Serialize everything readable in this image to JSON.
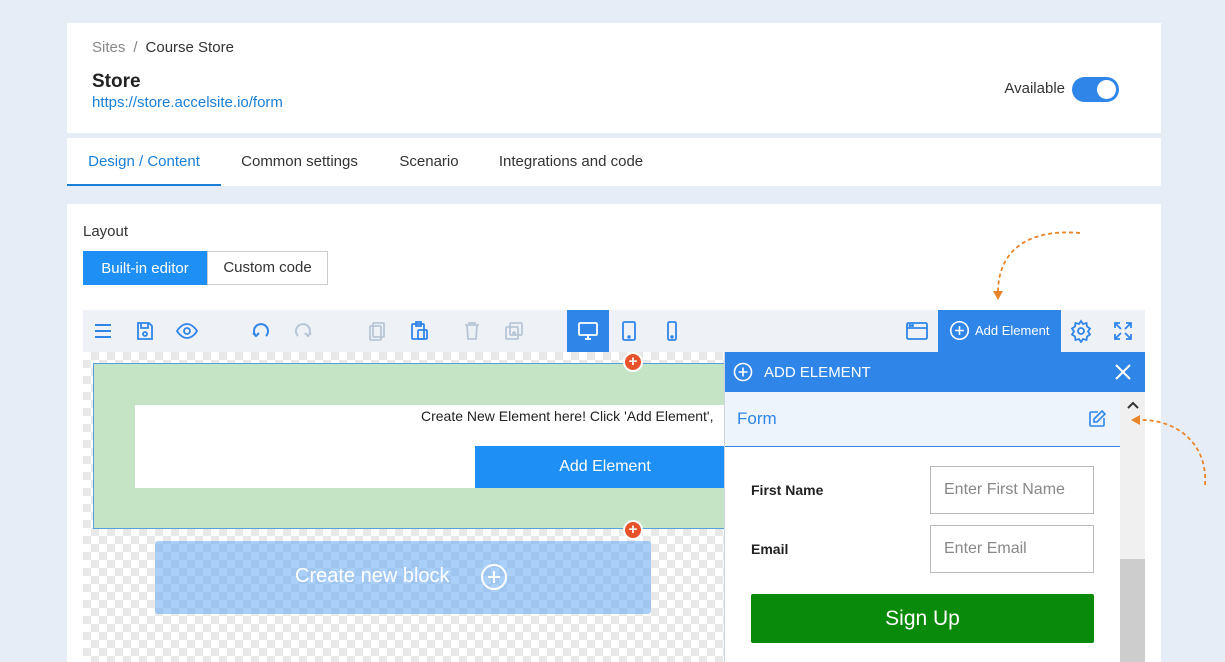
{
  "header": {
    "breadcrumb": {
      "root": "Sites",
      "separator": "/",
      "current": "Course Store"
    },
    "site_title": "Store",
    "site_url": "https://store.accelsite.io/form",
    "availability_label": "Available",
    "availability_on": true
  },
  "tabs": [
    {
      "label": "Design / Content",
      "active": true
    },
    {
      "label": "Common settings",
      "active": false
    },
    {
      "label": "Scenario",
      "active": false
    },
    {
      "label": "Integrations and code",
      "active": false
    }
  ],
  "editor": {
    "layout_label": "Layout",
    "layout_modes": {
      "builtin": "Built-in editor",
      "custom": "Custom code",
      "selected": "builtin"
    },
    "toolbar": {
      "icons": [
        "menu-icon",
        "save-icon",
        "preview-eye-icon",
        "undo-icon",
        "redo-icon",
        "copy-icon",
        "paste-icon",
        "delete-icon",
        "duplicate-icon",
        "desktop-icon",
        "tablet-icon",
        "mobile-icon",
        "browser-window-icon",
        "gear-icon",
        "fullscreen-icon"
      ],
      "active_device": "desktop",
      "add_element_label": "Add Element"
    },
    "canvas": {
      "create_text": "Create New Element here! Click 'Add Element',",
      "add_element_button": "Add Element",
      "new_block_label": "Create new block"
    },
    "panel": {
      "title": "ADD ELEMENT",
      "section_label": "Form",
      "fields": [
        {
          "label": "First Name",
          "placeholder": "Enter First Name"
        },
        {
          "label": "Email",
          "placeholder": "Enter Email"
        }
      ],
      "submit_label": "Sign Up"
    }
  },
  "colors": {
    "accent": "#2f86e8",
    "primary_button": "#1e8ff5",
    "signup_green": "#0a8a0a",
    "insert_dot": "#e8522a",
    "hint_arrow": "#e8852a"
  }
}
